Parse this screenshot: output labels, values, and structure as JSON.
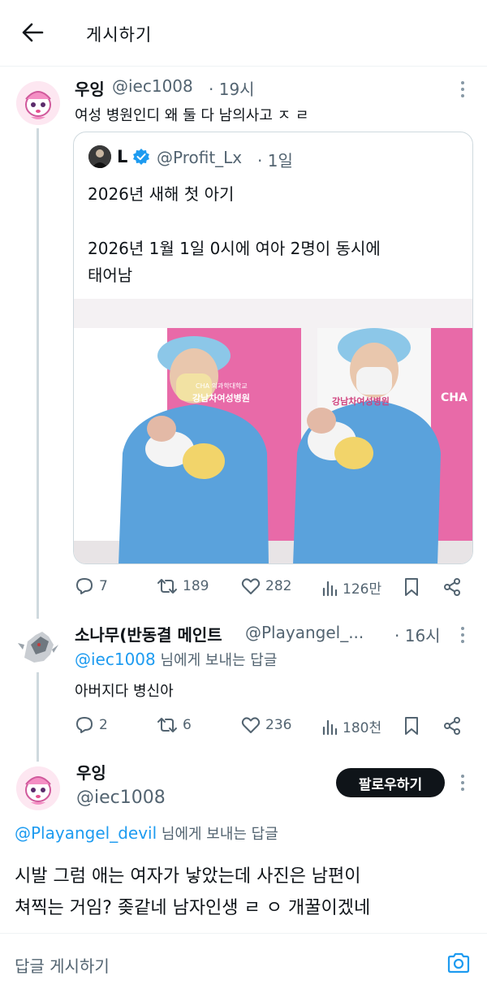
{
  "header": {
    "title": "게시하기",
    "back_icon": "arrow-left-icon"
  },
  "post1": {
    "name": "우잉",
    "handle": "@iec1008",
    "time": "· 19시",
    "text": "여성 병원인디 왜 둘 다 남의사고 ㅈ ㄹ",
    "quote": {
      "name": "L",
      "handle": "@Profit_Lx",
      "time": "· 1일",
      "line1": "2026년 새해 첫 아기",
      "line2": "2026년 1월 1일 0시에 여아 2명이 동시에",
      "line3": "태어남",
      "photo_sign_left": "강남차여성병원",
      "photo_sign_left_small": "CHA 의과학대학교",
      "photo_sign_right": "강남차여성병원",
      "photo_logo": "CHA"
    },
    "actions": {
      "replies": "7",
      "reposts": "189",
      "likes": "282",
      "views": "126만"
    }
  },
  "post2": {
    "name": "소나무(반동결 메인트",
    "handle": "@Playangel_...",
    "time": "· 16시",
    "reply_to_handle": "@iec1008",
    "reply_to_suffix": " 님에게 보내는 답글",
    "text": "아버지다 병신아",
    "actions": {
      "replies": "2",
      "reposts": "6",
      "likes": "236",
      "views": "180천"
    }
  },
  "post3": {
    "name": "우잉",
    "handle": "@iec1008",
    "follow_label": "팔로우하기",
    "reply_to_handle": "@Playangel_devil",
    "reply_to_suffix": " 님에게 보내는 답글",
    "text_line1": "시발 그럼 애는 여자가 낳았는데 사진은 남편이",
    "text_line2": "쳐찍는 거임? 좆같네 남자인생 ㄹ ㅇ 개꿀이겠네"
  },
  "composer": {
    "placeholder": "답글 게시하기",
    "camera_icon": "camera-icon"
  },
  "colors": {
    "accent": "#1d9bf0",
    "text": "#0f1419",
    "muted": "#536471",
    "border": "#cfd9de",
    "gown": "#5aa2dc"
  }
}
